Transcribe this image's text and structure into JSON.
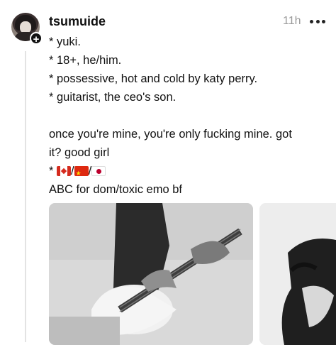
{
  "post": {
    "author": {
      "username": "tsumuide",
      "follow_symbol": "+"
    },
    "time_ago": "11h",
    "lines": [
      "* yuki.",
      "* 18+, he/him.",
      "* possessive, hot and cold by katy perry.",
      "* guitarist, the ceo's son.",
      "",
      "once you're mine, you're only fucking mine. got",
      "it? good girl",
      {
        "prefix": "* ",
        "flags": [
          "canada-flag",
          "china-flag",
          "japan-flag"
        ],
        "separator": "/"
      },
      "ABC for dom/toxic emo bf"
    ],
    "media": [
      {
        "name": "guitar-photo",
        "description_kind": "image"
      },
      {
        "name": "portrait-photo",
        "description_kind": "image"
      }
    ]
  },
  "icons": {
    "more": "more-horizontal-icon",
    "follow": "plus-icon"
  },
  "colors": {
    "text": "#111111",
    "muted": "#9a9a9a",
    "thread_line": "#e3e3e3"
  }
}
